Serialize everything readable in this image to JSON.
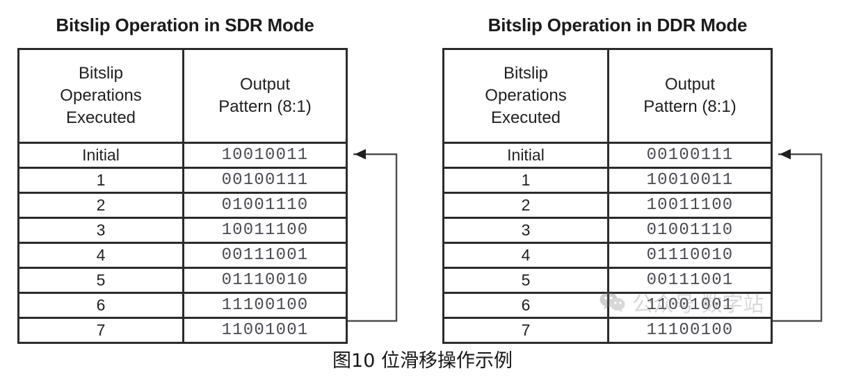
{
  "figure": {
    "caption": "图10 位滑移操作示例",
    "watermark_text": "公众号 数字站",
    "watermark_icon": "wechat-icon",
    "border_color": "#2b2b2b",
    "pattern_text_color": "#4a4a52"
  },
  "panels": [
    {
      "id": "sdr",
      "title": "Bitslip Operation in SDR Mode",
      "headers": {
        "operations": "Bitslip\nOperations\nExecuted",
        "pattern": "Output\nPattern (8:1)"
      },
      "rows": [
        {
          "ops": "Initial",
          "pattern": "10010011"
        },
        {
          "ops": "1",
          "pattern": "00100111"
        },
        {
          "ops": "2",
          "pattern": "01001110"
        },
        {
          "ops": "3",
          "pattern": "10011100"
        },
        {
          "ops": "4",
          "pattern": "00111001"
        },
        {
          "ops": "5",
          "pattern": "01110010"
        },
        {
          "ops": "6",
          "pattern": "11100100"
        },
        {
          "ops": "7",
          "pattern": "11001001"
        }
      ],
      "feedback_arrow": "loops from last row back to initial row"
    },
    {
      "id": "ddr",
      "title": "Bitslip Operation in DDR Mode",
      "headers": {
        "operations": "Bitslip\nOperations\nExecuted",
        "pattern": "Output\nPattern (8:1)"
      },
      "rows": [
        {
          "ops": "Initial",
          "pattern": "00100111"
        },
        {
          "ops": "1",
          "pattern": "10010011"
        },
        {
          "ops": "2",
          "pattern": "10011100"
        },
        {
          "ops": "3",
          "pattern": "01001110"
        },
        {
          "ops": "4",
          "pattern": "01110010"
        },
        {
          "ops": "5",
          "pattern": "00111001"
        },
        {
          "ops": "6",
          "pattern": "11001001"
        },
        {
          "ops": "7",
          "pattern": "11100100"
        }
      ],
      "feedback_arrow": "loops from last row back to initial row"
    }
  ]
}
